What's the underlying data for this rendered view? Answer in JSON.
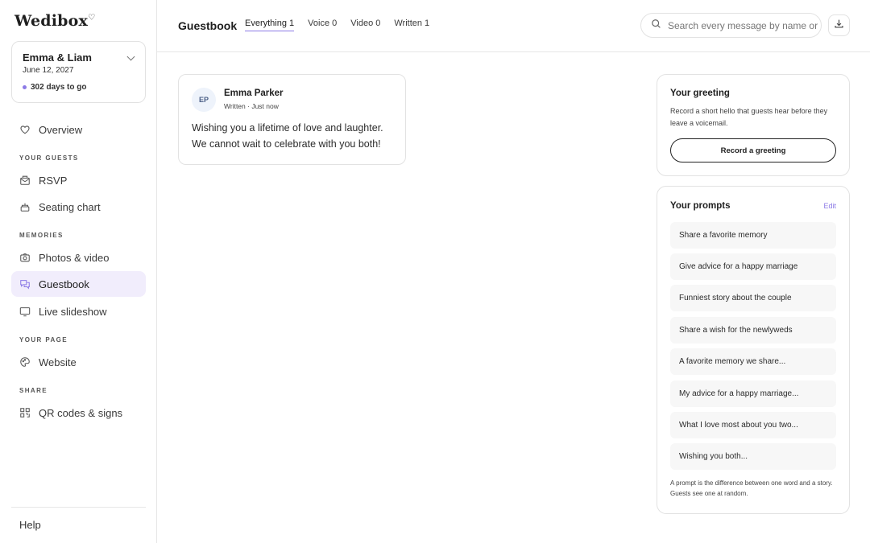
{
  "sidebar": {
    "logo": "Wedibox",
    "event": {
      "name": "Emma & Liam",
      "date": "June 12, 2027",
      "countdown": "302 days to go"
    },
    "overview": "Overview",
    "sections": {
      "guests": "YOUR GUESTS",
      "memories": "MEMORIES",
      "page": "YOUR PAGE",
      "share": "SHARE"
    },
    "items": {
      "rsvp": "RSVP",
      "seating": "Seating chart",
      "photos": "Photos & video",
      "guestbook": "Guestbook",
      "slideshow": "Live slideshow",
      "website": "Website",
      "qr": "QR codes & signs"
    },
    "help": "Help",
    "accent_color": "#8c7ae6",
    "active_bg": "#f1edfc"
  },
  "header": {
    "title": "Guestbook",
    "tabs": [
      {
        "label": "Everything 1"
      },
      {
        "label": "Voice 0"
      },
      {
        "label": "Video 0"
      },
      {
        "label": "Written 1"
      }
    ],
    "search_placeholder": "Search every message by name or"
  },
  "messages": [
    {
      "initials": "EP",
      "name": "Emma Parker",
      "meta": "Written · Just now",
      "text": "Wishing you a lifetime of love and laughter. We cannot wait to celebrate with you both!"
    }
  ],
  "greeting": {
    "title": "Your greeting",
    "description": "Record a short hello that guests hear before they leave a voicemail.",
    "button": "Record a greeting"
  },
  "prompts": {
    "title": "Your prompts",
    "edit": "Edit",
    "items": [
      "Share a favorite memory",
      "Give advice for a happy marriage",
      "Funniest story about the couple",
      "Share a wish for the newlyweds",
      "A favorite memory we share...",
      "My advice for a happy marriage...",
      "What I love most about you two...",
      "Wishing you both..."
    ],
    "note": "A prompt is the difference between one word and a story. Guests see one at random."
  }
}
